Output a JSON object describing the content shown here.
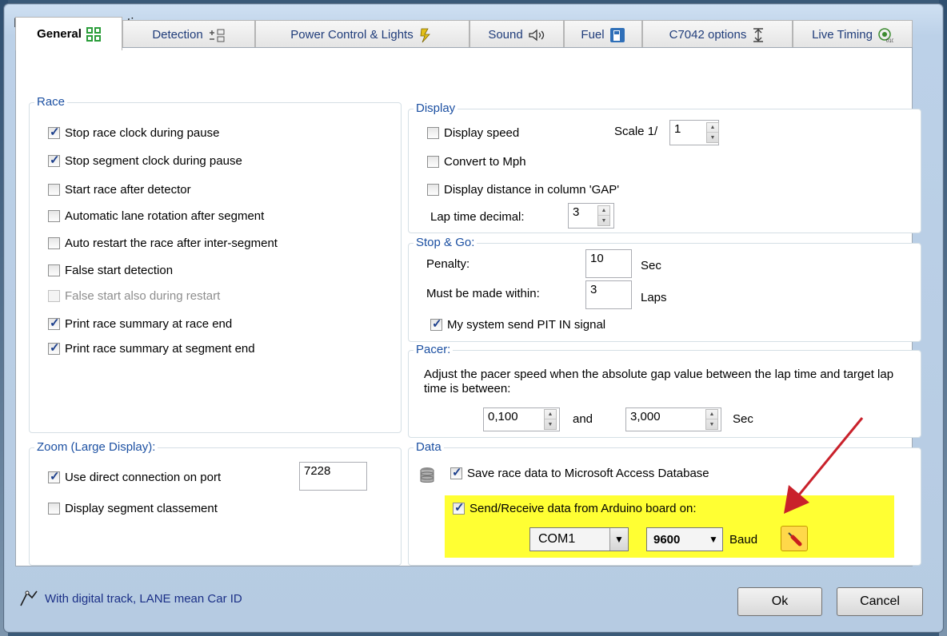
{
  "window": {
    "title": "Pc Lap counter Options"
  },
  "tabs": [
    {
      "label": "General",
      "icon": "general-icon"
    },
    {
      "label": "Detection",
      "icon": "detection-icon"
    },
    {
      "label": "Power Control & Lights",
      "icon": "lightning-icon"
    },
    {
      "label": "Sound",
      "icon": "sound-icon"
    },
    {
      "label": "Fuel",
      "icon": "fuel-icon"
    },
    {
      "label": "C7042 options",
      "icon": "c7042-icon"
    },
    {
      "label": "Live Timing",
      "icon": "live-timing-icon"
    }
  ],
  "race": {
    "title": "Race",
    "items": [
      {
        "label": "Stop race clock during pause",
        "checked": true
      },
      {
        "label": "Stop segment clock during pause",
        "checked": true
      },
      {
        "label": "Start race after detector",
        "checked": false
      },
      {
        "label": "Automatic lane rotation after segment",
        "checked": false
      },
      {
        "label": "Auto restart the race after inter-segment",
        "checked": false
      },
      {
        "label": "False start detection",
        "checked": false
      },
      {
        "label": "False start also during restart",
        "checked": false,
        "disabled": true
      },
      {
        "label": "Print race summary at race end",
        "checked": true
      },
      {
        "label": "Print race summary at segment end",
        "checked": true
      }
    ]
  },
  "display": {
    "title": "Display",
    "display_speed": "Display speed",
    "convert_mph": "Convert to Mph",
    "display_distance": "Display distance in column 'GAP'",
    "scale_label": "Scale 1/",
    "scale_value": "1",
    "lap_decimal_label": "Lap time decimal:",
    "lap_decimal_value": "3"
  },
  "stopgo": {
    "title": "Stop & Go:",
    "penalty_label": "Penalty:",
    "penalty_value": "10",
    "penalty_unit": "Sec",
    "within_label": "Must be made within:",
    "within_value": "3",
    "within_unit": "Laps",
    "pit_label": "My system send PIT IN signal"
  },
  "pacer": {
    "title": "Pacer:",
    "text": "Adjust the pacer speed when the absolute gap value between the lap time and target lap time is between:",
    "min_value": "0,100",
    "and_label": "and",
    "max_value": "3,000",
    "unit": "Sec"
  },
  "zoom": {
    "title": "Zoom (Large Display):",
    "direct_label": "Use direct connection on port",
    "port_value": "7228",
    "segment_label": "Display segment classement"
  },
  "data": {
    "title": "Data",
    "access_label": "Save race data to Microsoft Access Database",
    "arduino_label": "Send/Receive data from Arduino board on:",
    "com_value": "COM1",
    "baud_value": "9600",
    "baud_label": "Baud",
    "highlight_color": "#ffff33",
    "arrow_color": "#c9212b"
  },
  "footer": {
    "status": "With digital track, LANE mean Car ID",
    "ok": "Ok",
    "cancel": "Cancel"
  }
}
